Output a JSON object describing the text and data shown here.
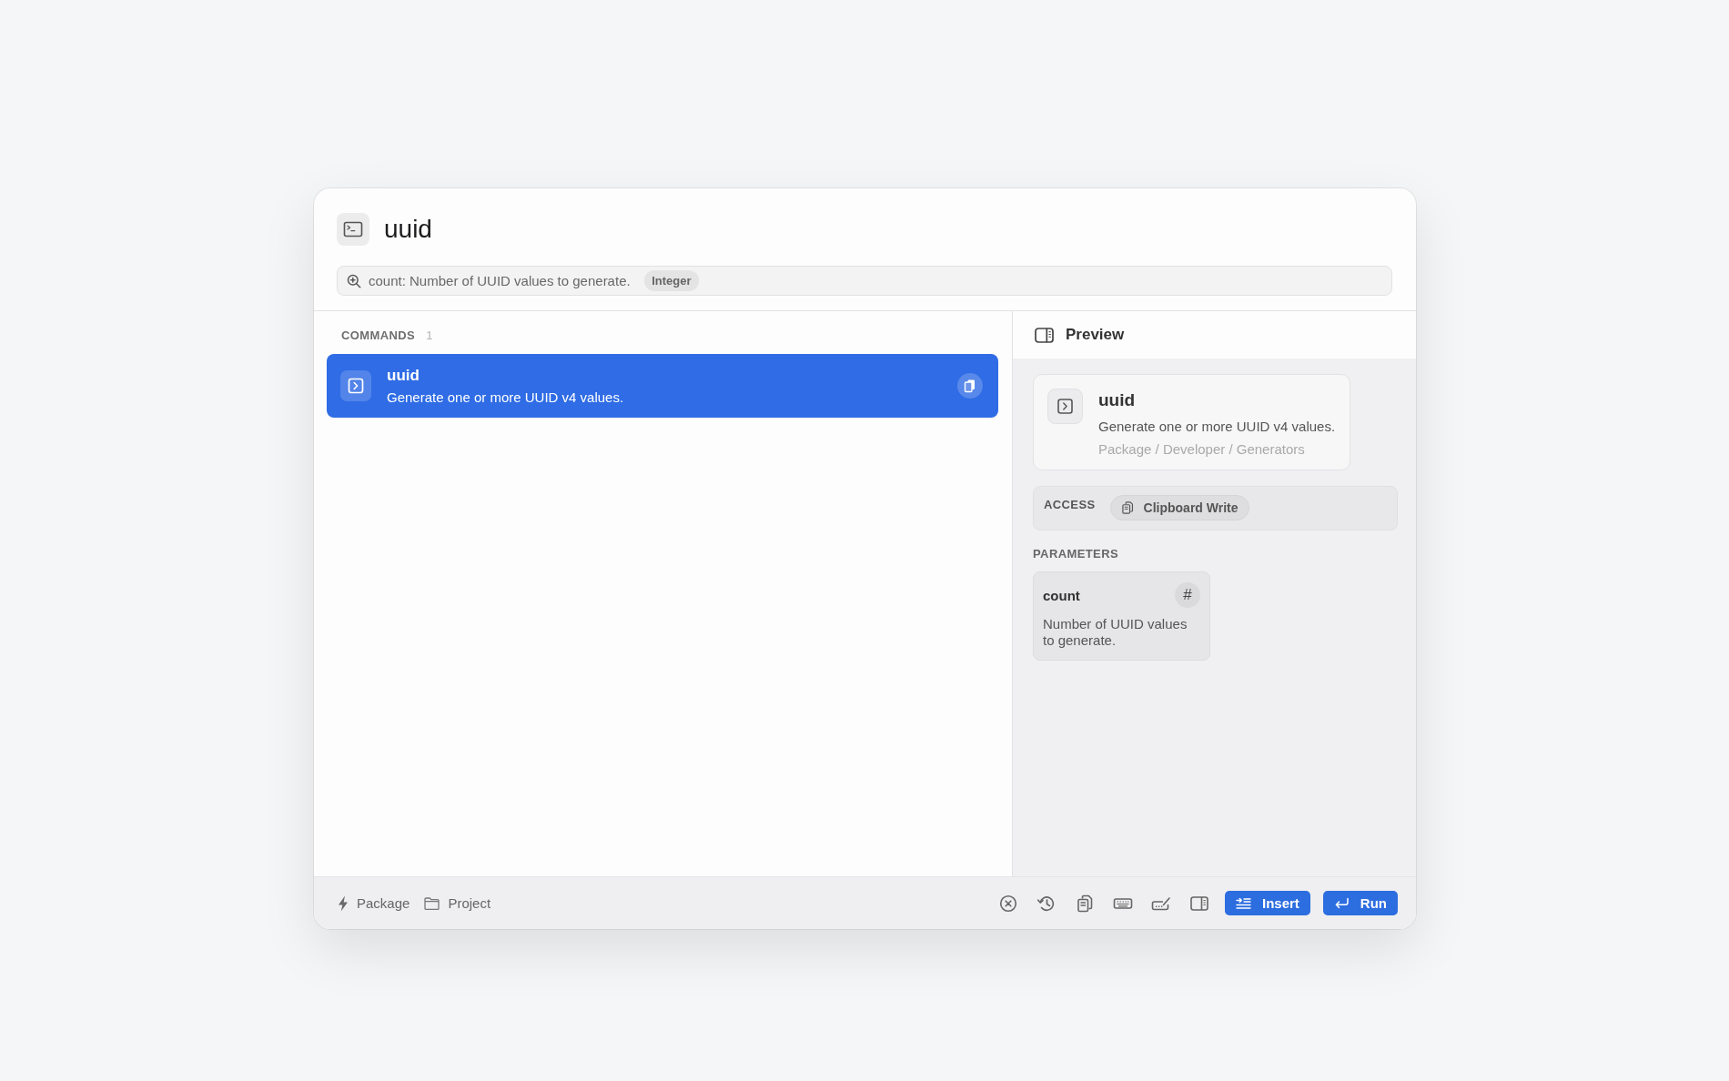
{
  "header": {
    "title": "uuid"
  },
  "argument_field": {
    "placeholder": "count: Number of UUID values to generate.",
    "type_tag": "Integer"
  },
  "commands": {
    "heading": "COMMANDS",
    "count": "1",
    "items": [
      {
        "title": "uuid",
        "description": "Generate one or more UUID v4 values.",
        "selected": true
      }
    ]
  },
  "preview": {
    "heading": "Preview",
    "card": {
      "title": "uuid",
      "description": "Generate one or more UUID v4 values.",
      "path": "Package / Developer / Generators"
    },
    "access": {
      "label": "ACCESS",
      "chips": [
        "Clipboard Write"
      ]
    },
    "parameters": {
      "heading": "PARAMETERS",
      "items": [
        {
          "name": "count",
          "symbol": "#",
          "description": "Number of UUID values to generate."
        }
      ]
    }
  },
  "footer": {
    "scopes": [
      "Package",
      "Project"
    ],
    "buttons": [
      "Insert",
      "Run"
    ]
  }
}
